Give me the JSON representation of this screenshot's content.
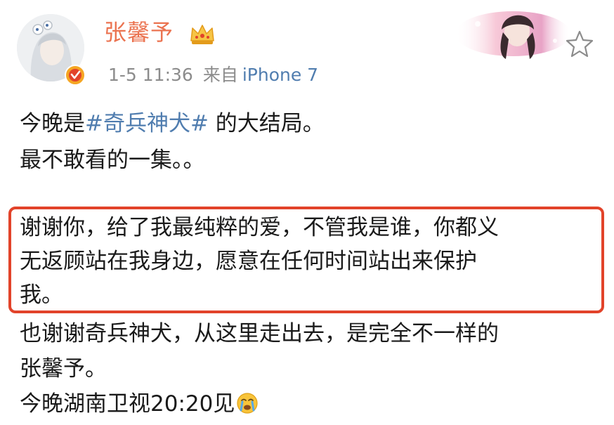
{
  "header": {
    "username": "张馨予",
    "timestamp": "1-5 11:36",
    "from_label": "来自",
    "source": "iPhone 7",
    "icons": {
      "verified": "verified-badge-icon",
      "crown": "crown-icon",
      "favorite": "star-outline-icon"
    }
  },
  "post": {
    "line1_prefix": "今晚是",
    "line1_topic": "#奇兵神犬#",
    "line1_suffix": " 的大结局。",
    "line2": "最不敢看的一集。。",
    "highlight_lines": [
      "谢谢你，给了我最纯粹的爱，不管我是谁，你都义",
      "无返顾站在我身边，愿意在任何时间站出来保护",
      "我。"
    ],
    "tail_lines": [
      "也谢谢奇兵神犬，从这里走出去，是完全不一样的",
      "张馨予。"
    ],
    "last_line": "今晚湖南卫视20:20见",
    "last_emoji": "crying-face-icon"
  },
  "colors": {
    "username": "#eb7350",
    "meta": "#8c8c8c",
    "link": "#507daf",
    "highlight_border": "#e2432a",
    "text": "#1a1a1a"
  }
}
